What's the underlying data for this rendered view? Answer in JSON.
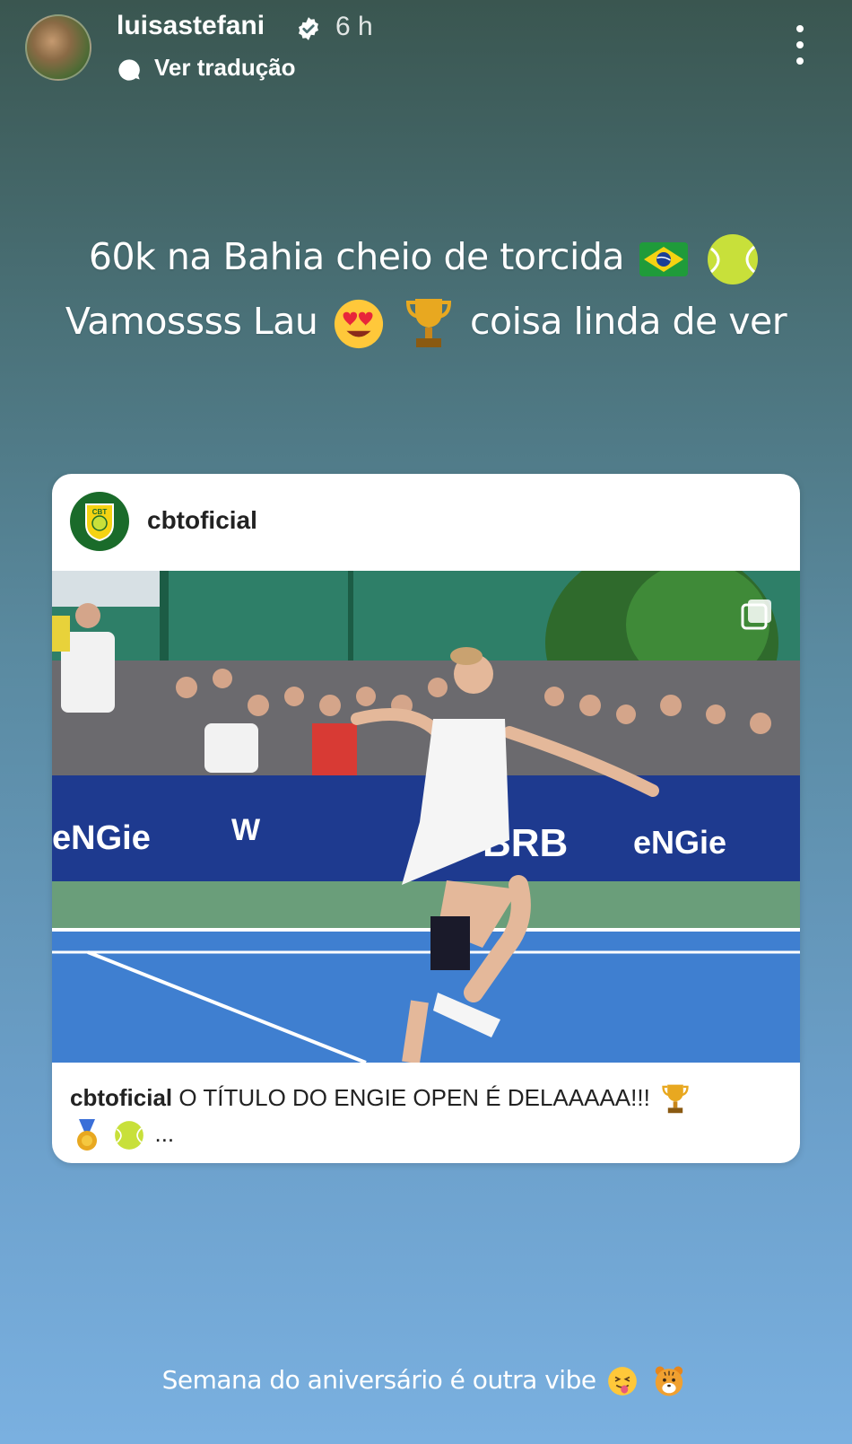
{
  "header": {
    "username": "luisastefani",
    "time": "6 h",
    "translate_label": "Ver tradução"
  },
  "story": {
    "line1_text": "60k na Bahia cheio de torcida",
    "line2_start": "Vamossss Lau",
    "line2_end": "coisa linda de ver"
  },
  "shared_post": {
    "username": "cbtoficial",
    "caption_user": "cbtoficial",
    "caption_text": "O TÍTULO DO ENGIE OPEN É DELAAAAA!!!",
    "caption_more": "...",
    "banner_text_left": "eNGie",
    "banner_text_mid": "BRB",
    "banner_text_right": "eNGie",
    "logo_text": "CBT"
  },
  "footer": {
    "text": "Semana do aniversário é outra vibe"
  },
  "colors": {
    "court_blue": "#3f7fd0",
    "banner_blue": "#1e3a8f",
    "tennis_ball": "#c8e03a",
    "cbt_green": "#1a6b2a"
  },
  "icons": [
    "verified-icon",
    "translate-icon",
    "more-icon",
    "brazil-flag-icon",
    "tennis-ball-icon",
    "heart-eyes-icon",
    "trophy-icon",
    "medal-icon",
    "multi-image-icon",
    "tongue-face-icon",
    "tiger-icon"
  ]
}
